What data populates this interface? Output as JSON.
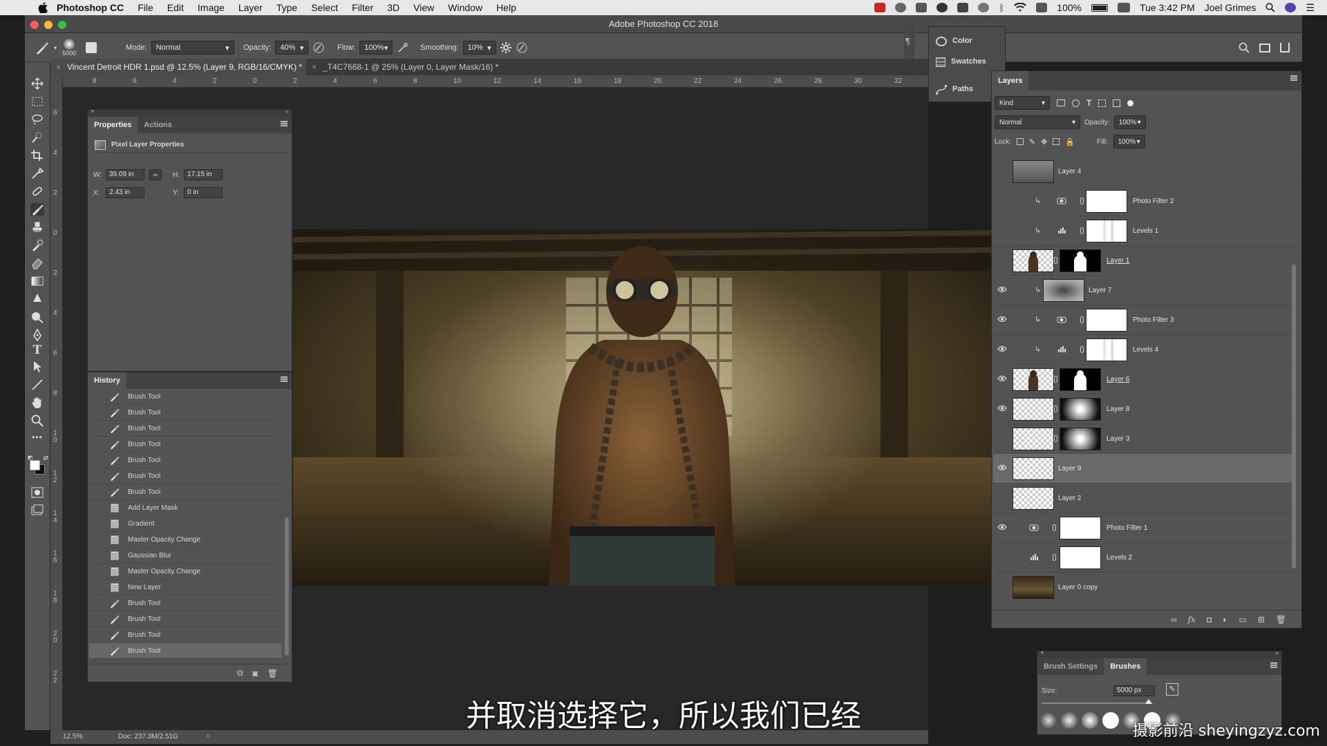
{
  "menubar": {
    "app_name": "Photoshop CC",
    "items": [
      "File",
      "Edit",
      "Image",
      "Layer",
      "Type",
      "Select",
      "Filter",
      "3D",
      "View",
      "Window",
      "Help"
    ],
    "battery": "100%",
    "clock": "Tue 3:42 PM",
    "user": "Joel Grimes"
  },
  "window": {
    "title": "Adobe Photoshop CC 2018"
  },
  "options": {
    "brush_size": "5000",
    "mode_label": "Mode:",
    "mode_value": "Normal",
    "opacity_label": "Opacity:",
    "opacity_value": "40%",
    "flow_label": "Flow:",
    "flow_value": "100%",
    "smoothing_label": "Smoothing:",
    "smoothing_value": "10%"
  },
  "tabs": [
    {
      "label": "Vincent Detroit HDR 1.psd @ 12.5% (Layer 9, RGB/16/CMYK) *"
    },
    {
      "label": "_T4C7668-1 @ 25% (Layer 0, Layer Mask/16) *"
    }
  ],
  "ruler": {
    "h_ticks": [
      "8",
      "6",
      "4",
      "2",
      "0",
      "2",
      "4",
      "6",
      "8",
      "10",
      "12",
      "14",
      "16",
      "18",
      "20",
      "22",
      "24",
      "26",
      "28",
      "30",
      "32"
    ],
    "v_ticks": [
      "6",
      "4",
      "2",
      "0",
      "2",
      "4",
      "6",
      "8",
      "1 0",
      "1 2",
      "1 4",
      "1 6",
      "1 8",
      "2 0",
      "2 2"
    ]
  },
  "mini_panel": {
    "color": "Color",
    "swatches": "Swatches",
    "paths": "Paths"
  },
  "properties": {
    "tab_properties": "Properties",
    "tab_actions": "Actions",
    "heading": "Pixel Layer Properties",
    "w_label": "W:",
    "w_value": "39.09 in",
    "h_label": "H:",
    "h_value": "17.15 in",
    "x_label": "X:",
    "x_value": "2.43 in",
    "y_label": "Y:",
    "y_value": "0 in"
  },
  "history": {
    "title": "History",
    "items": [
      {
        "label": "Brush Tool",
        "icon": "brush-icon"
      },
      {
        "label": "Brush Tool",
        "icon": "brush-icon"
      },
      {
        "label": "Brush Tool",
        "icon": "brush-icon"
      },
      {
        "label": "Brush Tool",
        "icon": "brush-icon"
      },
      {
        "label": "Brush Tool",
        "icon": "brush-icon"
      },
      {
        "label": "Brush Tool",
        "icon": "brush-icon"
      },
      {
        "label": "Brush Tool",
        "icon": "brush-icon"
      },
      {
        "label": "Add Layer Mask",
        "icon": "document-icon"
      },
      {
        "label": "Gradient",
        "icon": "document-icon"
      },
      {
        "label": "Master Opacity Change",
        "icon": "document-icon"
      },
      {
        "label": "Gaussian Blur",
        "icon": "document-icon"
      },
      {
        "label": "Master Opacity Change",
        "icon": "document-icon"
      },
      {
        "label": "New Layer",
        "icon": "document-icon"
      },
      {
        "label": "Brush Tool",
        "icon": "brush-icon"
      },
      {
        "label": "Brush Tool",
        "icon": "brush-icon"
      },
      {
        "label": "Brush Tool",
        "icon": "brush-icon"
      },
      {
        "label": "Brush Tool",
        "icon": "brush-icon"
      }
    ]
  },
  "layers": {
    "title": "Layers",
    "filter_kind": "Kind",
    "blend_mode": "Normal",
    "opacity_label": "Opacity:",
    "opacity_value": "100%",
    "lock_label": "Lock:",
    "fill_label": "Fill:",
    "fill_value": "100%",
    "items": [
      {
        "name": "Layer 4",
        "visible": false,
        "type": "pixel",
        "underline": false
      },
      {
        "name": "Photo Filter 2",
        "visible": false,
        "type": "photo-filter",
        "clipped": true
      },
      {
        "name": "Levels 1",
        "visible": false,
        "type": "levels",
        "clipped": true
      },
      {
        "name": "Layer 1",
        "visible": false,
        "type": "masked",
        "underline": true
      },
      {
        "name": "Layer 7",
        "visible": true,
        "type": "clipped-pixel"
      },
      {
        "name": "Photo Filter 3",
        "visible": true,
        "type": "photo-filter",
        "clipped": true
      },
      {
        "name": "Levels 4",
        "visible": true,
        "type": "levels",
        "clipped": true
      },
      {
        "name": "Layer 6",
        "visible": true,
        "type": "masked",
        "underline": true
      },
      {
        "name": "Layer 8",
        "visible": true,
        "type": "radial"
      },
      {
        "name": "Layer 3",
        "visible": false,
        "type": "radial"
      },
      {
        "name": "Layer 9",
        "visible": true,
        "type": "transparent",
        "selected": true
      },
      {
        "name": "Layer 2",
        "visible": false,
        "type": "transparent"
      },
      {
        "name": "Photo Filter 1",
        "visible": true,
        "type": "photo-filter-root"
      },
      {
        "name": "Levels 2",
        "visible": false,
        "type": "levels-root"
      },
      {
        "name": "Layer 0 copy",
        "visible": false,
        "type": "photo"
      }
    ]
  },
  "brushes": {
    "tab_settings": "Brush Settings",
    "tab_brushes": "Brushes",
    "size_label": "Size:",
    "size_value": "5000 px"
  },
  "status": {
    "zoom": "12.5%",
    "doc": "Doc: 237.3M/2.51G"
  },
  "subtitle": "并取消选择它，所以我们已经",
  "watermark": "摄影前沿 sheyingzyz.com"
}
